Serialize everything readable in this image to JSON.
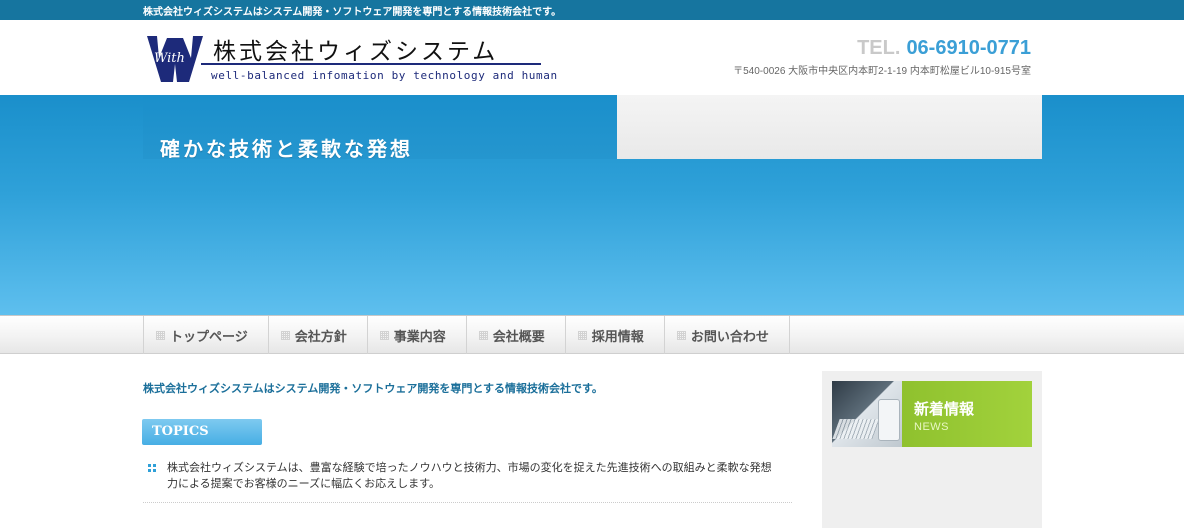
{
  "colors": {
    "topbar": "#16759f",
    "accent_blue": "#3b9fd6",
    "logo_navy": "#1d2a7a",
    "news_green": "#a2d23c"
  },
  "topbar": {
    "text": "株式会社ウィズシステムはシステム開発・ソフトウェア開発を専門とする情報技術会社です。"
  },
  "header": {
    "logo_text": "With",
    "company_name": "株式会社ウィズシステム",
    "tagline": "well-balanced infomation by technology and human",
    "tel_label": "TEL.",
    "tel_number": "06-6910-0771",
    "address": "〒540-0026 大阪市中央区内本町2-1-19 内本町松屋ビル10-915号室"
  },
  "hero": {
    "title": "確かな技術と柔軟な発想"
  },
  "nav": {
    "items": [
      {
        "label": "トップページ"
      },
      {
        "label": "会社方針"
      },
      {
        "label": "事業内容"
      },
      {
        "label": "会社概要"
      },
      {
        "label": "採用情報"
      },
      {
        "label": "お問い合わせ"
      }
    ]
  },
  "main": {
    "intro": "株式会社ウィズシステムはシステム開発・ソフトウェア開発を専門とする情報技術会社です。",
    "topics_label": "TOPICS",
    "topics": [
      {
        "text": "株式会社ウィズシステムは、豊富な経験で培ったノウハウと技術力、市場の変化を捉えた先進技術への取組みと柔軟な発想力による提案でお客様のニーズに幅広くお応えします。"
      }
    ]
  },
  "sidebar": {
    "news_title": "新着情報",
    "news_sub": "NEWS"
  }
}
